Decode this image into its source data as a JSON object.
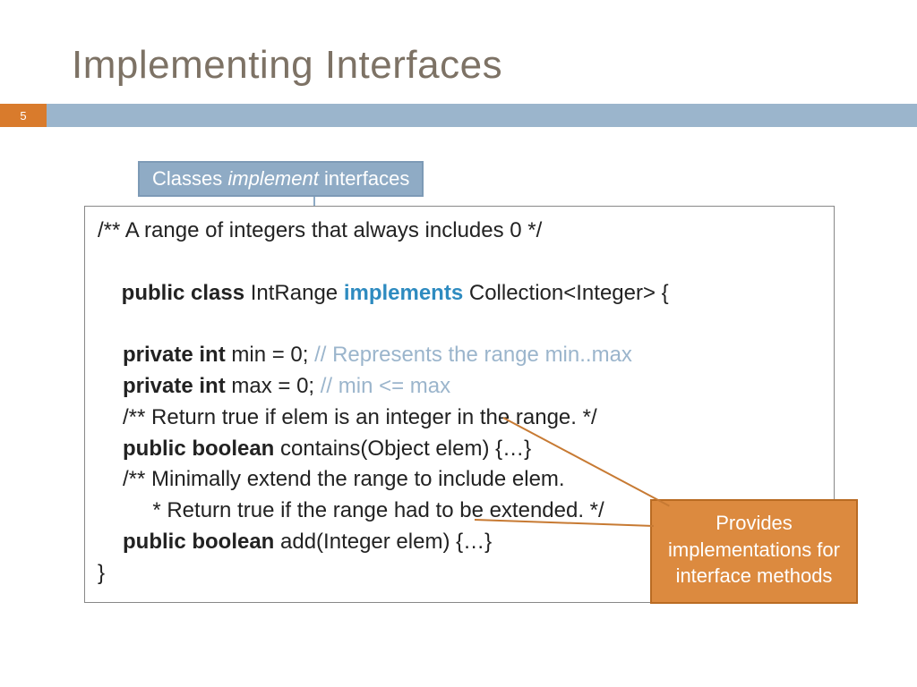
{
  "title": "Implementing Interfaces",
  "page_number": "5",
  "callout_top": {
    "pre": "Classes ",
    "em": "implement",
    "post": " interfaces"
  },
  "code": {
    "l1": "/** A range of integers that always includes 0 */",
    "l2_kw": "public class",
    "l2_a": " IntRange ",
    "l2_hl": "implements",
    "l2_b": " Collection<Integer> {",
    "l3_kw": "private int",
    "l3_a": " min = 0; ",
    "l3_cm": "// Represents the range min..max",
    "l4_kw": "private int",
    "l4_a": " max = 0; ",
    "l4_cm": "// min <= max",
    "l5": "/** Return true if elem is an integer in the range. */",
    "l6_kw": "public boolean",
    "l6_a": " contains(Object elem) {…}",
    "l7": "/** Minimally extend the range to include elem.",
    "l8": "  * Return true if the range had to be extended. */",
    "l9_kw": "public boolean",
    "l9_a": " add(Integer elem) {…}",
    "l10": "}"
  },
  "callout_orange": "Provides implementations for interface methods"
}
